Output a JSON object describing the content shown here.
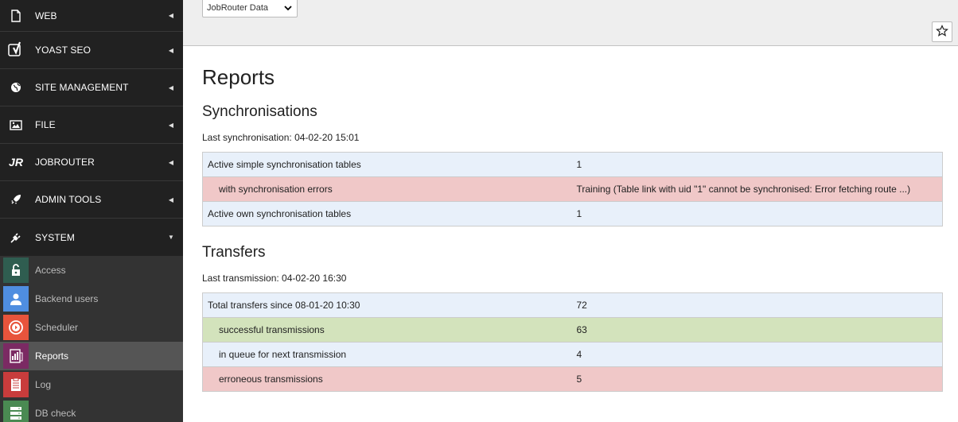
{
  "sidebar": {
    "groups": [
      {
        "label": "WEB",
        "icon": "page-icon",
        "state": "collapsed"
      },
      {
        "label": "YOAST SEO",
        "icon": "yoast-icon",
        "state": "collapsed"
      },
      {
        "label": "SITE MANAGEMENT",
        "icon": "globe-icon",
        "state": "collapsed"
      },
      {
        "label": "FILE",
        "icon": "image-icon",
        "state": "collapsed"
      },
      {
        "label": "JOBROUTER",
        "icon": "jobrouter-icon",
        "icon_text": "JR",
        "state": "collapsed"
      },
      {
        "label": "ADMIN TOOLS",
        "icon": "rocket-icon",
        "state": "collapsed"
      },
      {
        "label": "SYSTEM",
        "icon": "plug-icon",
        "state": "expanded"
      }
    ],
    "items": [
      {
        "label": "Access",
        "icon": "unlock-icon",
        "color": "#2f5d50"
      },
      {
        "label": "Backend users",
        "icon": "user-icon",
        "color": "#4f8ee0"
      },
      {
        "label": "Scheduler",
        "icon": "scheduler-icon",
        "color": "#e8543c"
      },
      {
        "label": "Reports",
        "icon": "reports-icon",
        "color": "#7b2a63",
        "active": true
      },
      {
        "label": "Log",
        "icon": "log-icon",
        "color": "#c83c3c"
      },
      {
        "label": "DB check",
        "icon": "database-icon",
        "color": "#4a8a52"
      }
    ]
  },
  "topbar": {
    "select_value": "JobRouter Data",
    "bookmark_icon": "star-icon"
  },
  "page": {
    "title": "Reports",
    "sync": {
      "heading": "Synchronisations",
      "last": "Last synchronisation: 04-02-20 15:01",
      "rows": [
        {
          "label": "Active simple synchronisation tables",
          "value": "1",
          "status": "info"
        },
        {
          "label": "with synchronisation errors",
          "value": "Training (Table link with uid \"1\" cannot be synchronised: Error fetching route ...)",
          "status": "error"
        },
        {
          "label": "Active own synchronisation tables",
          "value": "1",
          "status": "info"
        }
      ]
    },
    "transfers": {
      "heading": "Transfers",
      "last": "Last transmission: 04-02-20 16:30",
      "rows": [
        {
          "label": "Total transfers since 08-01-20 10:30",
          "value": "72",
          "status": "info"
        },
        {
          "label": "successful transmissions",
          "value": "63",
          "status": "success"
        },
        {
          "label": "in queue for next transmission",
          "value": "4",
          "status": "info"
        },
        {
          "label": "erroneous transmissions",
          "value": "5",
          "status": "error"
        }
      ]
    }
  },
  "colors": {
    "sidebar_bg": "#212121",
    "info_row": "#e8f0fa",
    "error_row": "#f0c8c8",
    "success_row": "#d3e3bc"
  }
}
